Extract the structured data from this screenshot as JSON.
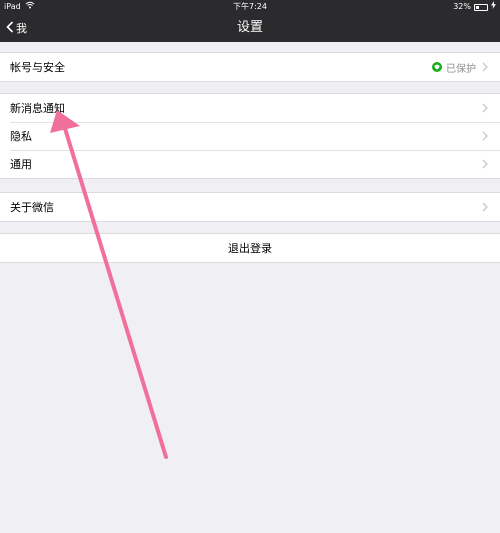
{
  "statusbar": {
    "device": "iPad",
    "time": "下午7:24",
    "battery": "32%"
  },
  "navbar": {
    "back_label": "我",
    "title": "设置"
  },
  "groups": {
    "account": {
      "label": "帐号与安全",
      "status": "已保护"
    },
    "messages": {
      "label": "新消息通知"
    },
    "privacy": {
      "label": "隐私"
    },
    "general": {
      "label": "通用"
    },
    "about": {
      "label": "关于微信"
    },
    "logout": {
      "label": "退出登录"
    }
  },
  "colors": {
    "bar": "#2b2b2d",
    "background": "#efeff4",
    "protected_green": "#1aad19",
    "annotation_arrow": "#f0709a"
  },
  "icons": [
    "wifi-icon",
    "back-chevron-icon",
    "shield-check-icon",
    "chevron-right-icon",
    "charging-icon"
  ]
}
